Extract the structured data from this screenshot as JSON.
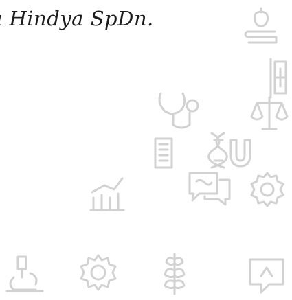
{
  "handwriting": {
    "text": "ı Hindya SpDn."
  },
  "icons": [
    "book-apple-icon",
    "hospital-sign-icon",
    "stethoscope-icon",
    "scales-of-justice-icon",
    "growth-chart-icon",
    "chat-bubbles-icon",
    "gear-icon",
    "dna-icon",
    "building-icon",
    "magnet-icon",
    "microscope-icon",
    "settings-gear-icon",
    "wheat-icon",
    "message-box-icon"
  ],
  "colors": {
    "icon_stroke": "#d2d2d2",
    "handwriting_ink": "#1c1c1c",
    "background": "#ffffff"
  }
}
